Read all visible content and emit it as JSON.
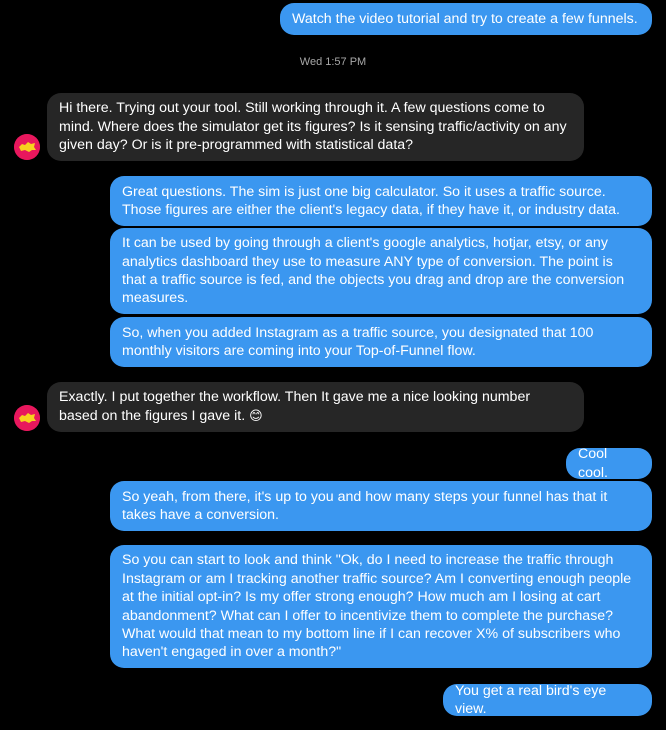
{
  "conversation": {
    "timestamp": "Wed 1:57 PM",
    "messages": [
      {
        "text": "Watch the video tutorial and try to create a few funnels."
      },
      {
        "text": "Hi there. Trying out your tool. Still working through it. A few questions come to mind. Where does the simulator get its figures? Is it sensing traffic/activity on any given day? Or is it pre-programmed with statistical data?"
      },
      {
        "text": "Great questions. The sim is just one big calculator. So it uses a traffic source. Those figures are either the client's legacy data, if they have it, or industry data."
      },
      {
        "text": "It can be used by going through a client's google analytics, hotjar, etsy, or any analytics dashboard they use to measure ANY type of conversion. The point is that a traffic source is fed, and the objects you drag and drop are the conversion measures."
      },
      {
        "text": "So, when you added Instagram as a traffic source, you designated that 100 monthly visitors are coming into your Top-of-Funnel flow."
      },
      {
        "text": "Exactly. I put together the workflow. Then It gave me a nice looking number based on the figures I gave it.",
        "emoji": "😊"
      },
      {
        "text": "Cool cool."
      },
      {
        "text": "So yeah, from there, it's up to you and how many steps your funnel has that it takes have a conversion."
      },
      {
        "text": "So you can start to look and think \"Ok, do I need to increase the traffic through Instagram or am I tracking another traffic source? Am I converting enough people at the initial opt-in? Is my offer strong enough? How much am I losing at cart abandonment? What can I offer to incentivize them to complete the purchase? What would that mean to my bottom line if I can recover X% of subscribers who haven't engaged in over a month?\""
      },
      {
        "text": "You get a real bird's eye view."
      }
    ]
  },
  "colors": {
    "background": "#000000",
    "outgoing_bubble": "#3b97f0",
    "incoming_bubble": "#262626",
    "timestamp_text": "#a8a8a8",
    "avatar_background": "#e8175d"
  },
  "avatar_icon": "contact-avatar-icon"
}
